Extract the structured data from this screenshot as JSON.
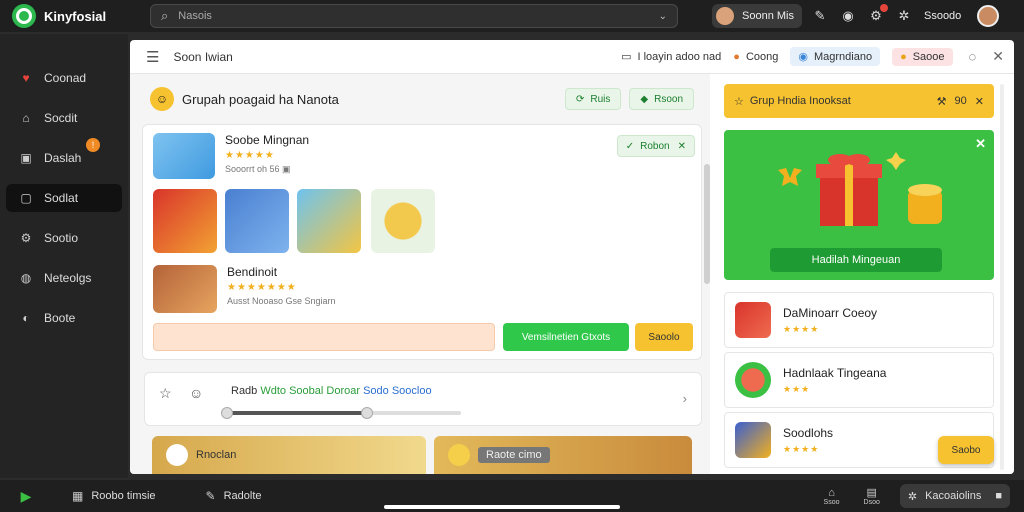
{
  "topbar": {
    "app_name": "Kinyfosial",
    "search_placeholder": "Nasois",
    "account_label": "Soonn Mis",
    "user_name": "Ssoodo"
  },
  "sidebar": {
    "items": [
      {
        "label": "Coonad",
        "icon": "heart-icon"
      },
      {
        "label": "Socdit",
        "icon": "home-icon"
      },
      {
        "label": "Daslah",
        "icon": "bag-icon",
        "badge": "!"
      },
      {
        "label": "Sodlat",
        "icon": "square-icon"
      },
      {
        "label": "Sootio",
        "icon": "gear-icon"
      },
      {
        "label": "Neteolgs",
        "icon": "globe-icon"
      },
      {
        "label": "Boote",
        "icon": "bell-icon"
      }
    ]
  },
  "window": {
    "title": "Soon Iwian",
    "chip1": "I loayin adoo nad",
    "chip2": "Coong",
    "chip3": "Magrndiano",
    "chip4": "Saooe"
  },
  "group": {
    "title": "Grupah poagaid ha Nanota",
    "btn1": "Ruis",
    "btn2": "Rsoon"
  },
  "apps": {
    "first": {
      "name": "Soobe Mingnan",
      "meta": "Sooorrt oh 56 ▣",
      "stars": "★★★★★"
    },
    "second": {
      "name": "Bendinoit",
      "meta": "Ausst Nooaso Gse Sngiarn",
      "stars": "★★★★★★★"
    },
    "close_chip": "Robon",
    "btn_green": "Vemsilnetien Gtxots",
    "btn_yellow": "Saoolo"
  },
  "player": {
    "part1": "Radb",
    "part2": "Wdto Soobal Doroar",
    "part3": "Sodo Soocloo",
    "progress": 0.6
  },
  "banners": {
    "left": "Rnoclan",
    "right": "Raote cimo"
  },
  "right_panel": {
    "head_title": "Grup Hndia Inooksat",
    "head_value": "90",
    "promo_button": "Hadilah Mingeuan",
    "items": [
      {
        "name": "DaMinoarr Coeoy",
        "stars": "★★★★"
      },
      {
        "name": "Hadnlaak Tingeana",
        "stars": "★★★"
      },
      {
        "name": "Soodlohs",
        "stars": "★★★★"
      }
    ],
    "cta": "Saobo"
  },
  "taskbar": {
    "item1": "Roobo timsie",
    "item2": "Radolte",
    "small1": "Ssoo",
    "small2": "Dsoo",
    "pill": "Kacoaiolins"
  },
  "colors": {
    "accent_green": "#2fc84b",
    "accent_yellow": "#f6c22f",
    "dark_bg": "#1f1f1f"
  }
}
